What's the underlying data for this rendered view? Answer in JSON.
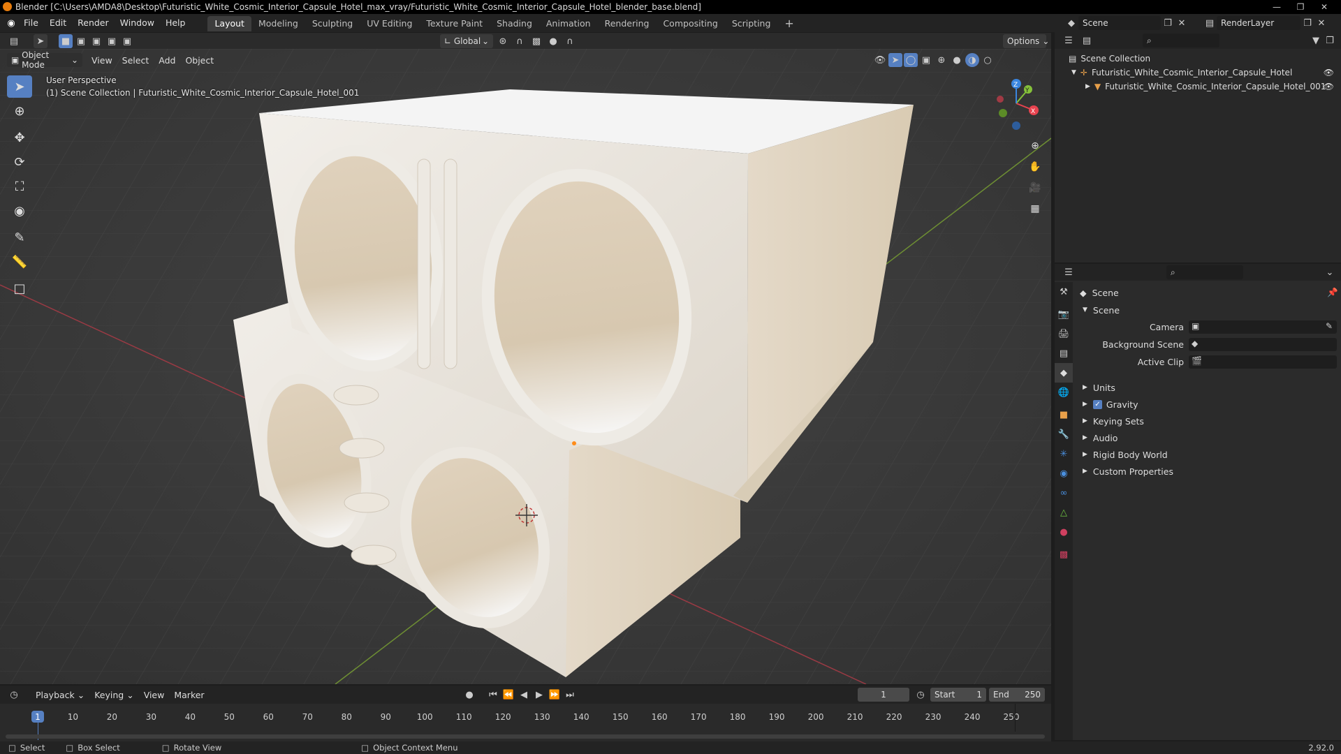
{
  "window": {
    "title": "Blender [C:\\Users\\AMDA8\\Desktop\\Futuristic_White_Cosmic_Interior_Capsule_Hotel_max_vray/Futuristic_White_Cosmic_Interior_Capsule_Hotel_blender_base.blend]"
  },
  "menu": [
    "File",
    "Edit",
    "Render",
    "Window",
    "Help"
  ],
  "workspaces": [
    "Layout",
    "Modeling",
    "Sculpting",
    "UV Editing",
    "Texture Paint",
    "Shading",
    "Animation",
    "Rendering",
    "Compositing",
    "Scripting"
  ],
  "scene_selector": {
    "scene": "Scene",
    "view_layer": "RenderLayer"
  },
  "viewport_header": {
    "transform_orientation": "Global",
    "options_label": "Options",
    "mode": "Object Mode",
    "menus": [
      "View",
      "Select",
      "Add",
      "Object"
    ]
  },
  "viewport": {
    "perspective_label": "User Perspective",
    "collection_label": "(1) Scene Collection | Futuristic_White_Cosmic_Interior_Capsule_Hotel_001",
    "gizmo_axes": {
      "x": "X",
      "y": "Y",
      "z": "Z"
    },
    "colors": {
      "x": "#e8434f",
      "y": "#85c13a",
      "z": "#3a86e0"
    }
  },
  "outliner": {
    "root": "Scene Collection",
    "items": [
      {
        "label": "Futuristic_White_Cosmic_Interior_Capsule_Hotel",
        "level": 1
      },
      {
        "label": "Futuristic_White_Cosmic_Interior_Capsule_Hotel_001",
        "level": 2
      }
    ]
  },
  "properties": {
    "breadcrumb": "Scene",
    "panel_title": "Scene",
    "fields": [
      {
        "label": "Camera"
      },
      {
        "label": "Background Scene"
      },
      {
        "label": "Active Clip"
      }
    ],
    "subpanels": [
      {
        "label": "Units",
        "checkbox": false
      },
      {
        "label": "Gravity",
        "checkbox": true,
        "checked": true
      },
      {
        "label": "Keying Sets",
        "checkbox": false
      },
      {
        "label": "Audio",
        "checkbox": false
      },
      {
        "label": "Rigid Body World",
        "checkbox": false
      },
      {
        "label": "Custom Properties",
        "checkbox": false
      }
    ]
  },
  "timeline": {
    "menus": [
      "Playback",
      "Keying",
      "View",
      "Marker"
    ],
    "current_frame": "1",
    "start_label": "Start",
    "start": "1",
    "end_label": "End",
    "end": "250",
    "ticks": [
      "1",
      "10",
      "20",
      "30",
      "40",
      "50",
      "60",
      "70",
      "80",
      "90",
      "100",
      "110",
      "120",
      "130",
      "140",
      "150",
      "160",
      "170",
      "180",
      "190",
      "200",
      "210",
      "220",
      "230",
      "240",
      "250"
    ]
  },
  "statusbar": {
    "select": "Select",
    "box_select": "Box Select",
    "rotate_view": "Rotate View",
    "context_menu": "Object Context Menu",
    "version": "2.92.0"
  },
  "accent_color": "#5680c2"
}
